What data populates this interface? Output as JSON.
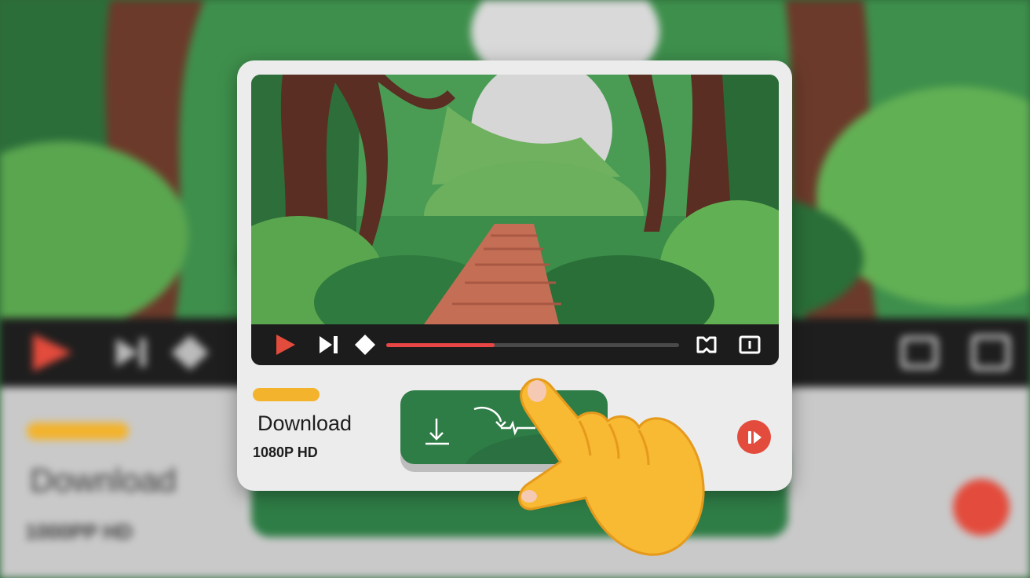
{
  "colors": {
    "accent_red": "#e34b3c",
    "progress_red": "#e84545",
    "pill_yellow": "#f3b32c",
    "button_green": "#2f7d46",
    "hand_yellow": "#f8b933"
  },
  "background": {
    "title": "Download",
    "subtitle": "1000PP HD"
  },
  "player": {
    "progress": 0.37,
    "icons": [
      "play-icon",
      "skip-next-icon",
      "diamond-icon",
      "fullscreen-icon",
      "window-icon"
    ]
  },
  "card": {
    "title": "Download",
    "quality": "1080P HD"
  },
  "download_button": {
    "icon": "download-arrow-icon"
  },
  "side_button": {
    "icon": "pause-forward-icon"
  }
}
